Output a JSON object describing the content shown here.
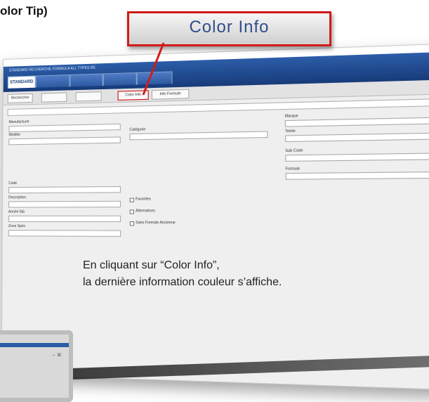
{
  "header": {
    "text": "olor Tip)"
  },
  "callout": {
    "label": "Color Info"
  },
  "window": {
    "title": "STANDARD RECHERCHE FORMULA ALL TYPES RE",
    "tabs": [
      "STANDARD",
      "",
      "",
      "",
      ""
    ],
    "subtabs": [
      "Rechercher",
      "",
      "",
      "Color Info",
      "Info Formule"
    ],
    "icons": "‑ ✕",
    "fields": {
      "left": [
        "Manufacturer",
        "Modèle",
        "Code",
        "Description",
        "Année fab",
        "Zone Spéc."
      ],
      "middle": [
        "Catégorie"
      ],
      "middle_checks": [
        "Favorites",
        "Alternatives",
        "Sans Formule Ancienne"
      ],
      "right": [
        "Marque",
        "Teinte",
        "Sub Code",
        "Formule"
      ]
    },
    "info_line1": "En cliquant sur “Color Info”,",
    "info_line2": "la dernière information couleur s’affiche."
  },
  "mini": {
    "icons": "‑ ✕"
  }
}
